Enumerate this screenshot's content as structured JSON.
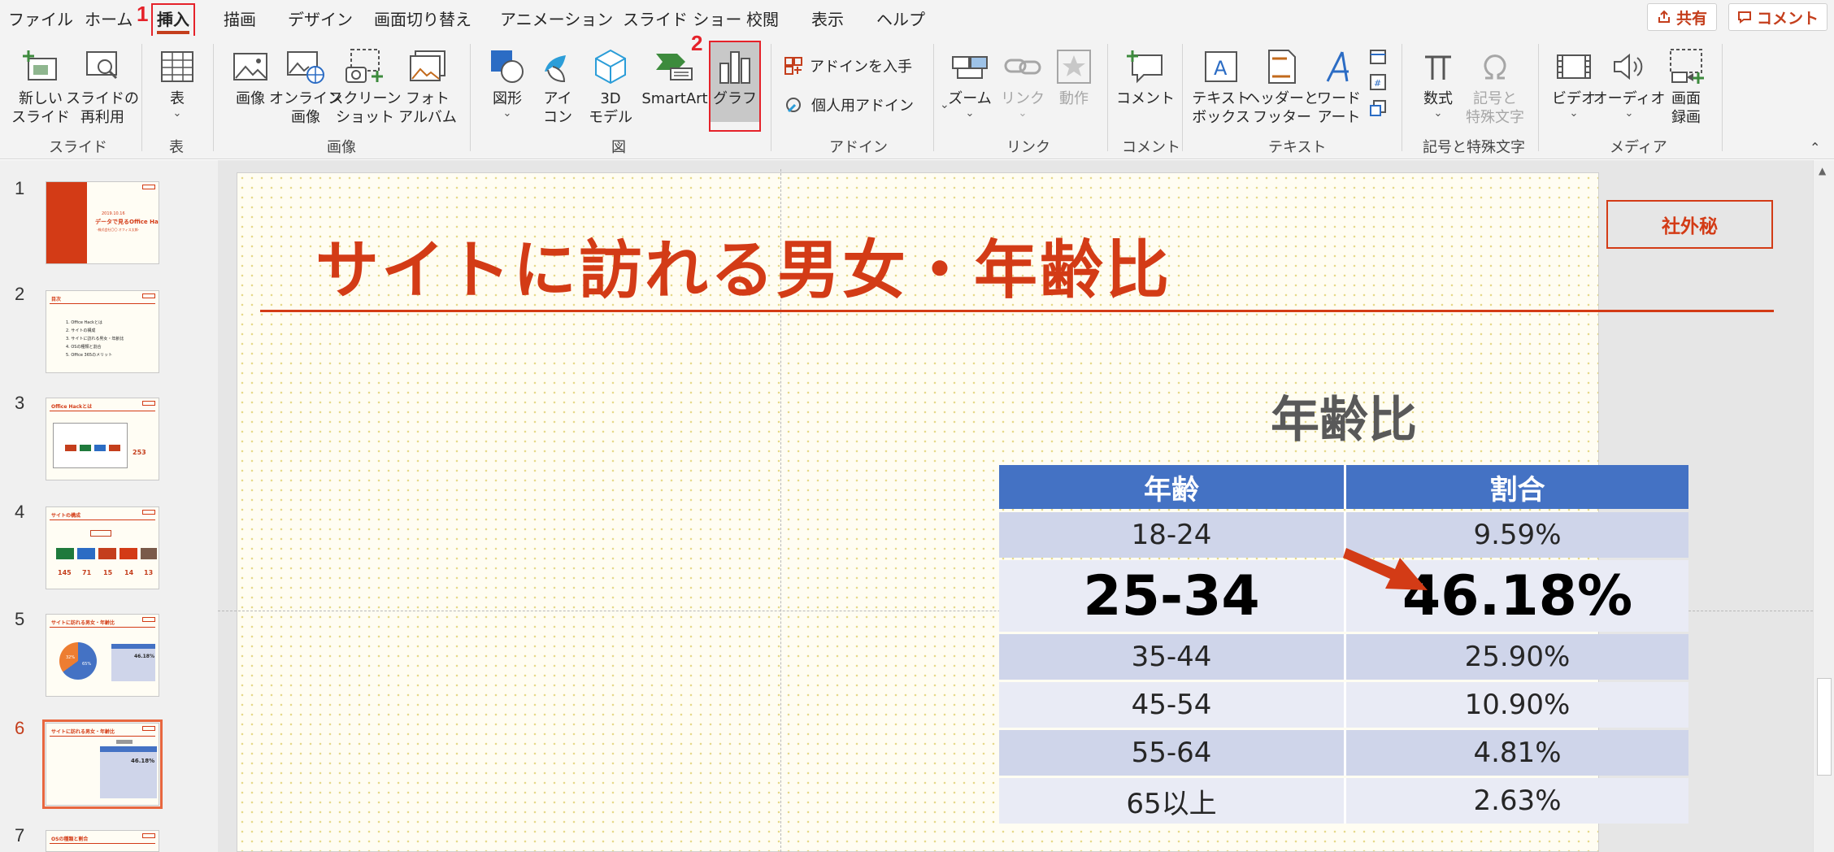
{
  "menu": {
    "items": [
      "ファイル",
      "ホーム",
      "挿入",
      "描画",
      "デザイン",
      "画面切り替え",
      "アニメーション",
      "スライド ショー",
      "校閲",
      "表示",
      "ヘルプ"
    ],
    "share_label": "共有",
    "comment_label": "コメント"
  },
  "annotations": {
    "step1": "1",
    "step2": "2"
  },
  "ribbon": {
    "new_slide": [
      "新しい",
      "スライド"
    ],
    "reuse_slide": [
      "スライドの",
      "再利用"
    ],
    "table": "表",
    "image": "画像",
    "online_image": [
      "オンライン",
      "画像"
    ],
    "screenshot": [
      "スクリーン",
      "ショット"
    ],
    "photo_album": [
      "フォト",
      "アルバム"
    ],
    "shapes": "図形",
    "icons": [
      "アイ",
      "コン"
    ],
    "model3d": [
      "3D",
      "モデル"
    ],
    "smartart": "SmartArt",
    "chart": "グラフ",
    "get_addins": "アドインを入手",
    "my_addins": "個人用アドイン",
    "zoom": "ズーム",
    "link": "リンク",
    "action": "動作",
    "comment": "コメント",
    "textbox": [
      "テキスト",
      "ボックス"
    ],
    "header_footer": [
      "ヘッダーと",
      "フッター"
    ],
    "wordart": [
      "ワード",
      "アート"
    ],
    "equation": "数式",
    "symbol": [
      "記号と",
      "特殊文字"
    ],
    "video": "ビデオ",
    "audio": "オーディオ",
    "screen_recording": [
      "画面",
      "録画"
    ],
    "groups": [
      "スライド",
      "表",
      "画像",
      "図",
      "アドイン",
      "リンク",
      "コメント",
      "テキスト",
      "記号と特殊文字",
      "メディア"
    ]
  },
  "thumbnails": [
    {
      "num": "1",
      "title": "2019.10.16",
      "subtitle": "データで見るOffice Hack",
      "byline": "-株式会社〇〇 オフィス太郎-"
    },
    {
      "num": "2",
      "title": "目次",
      "lines": [
        "1. Office Hackとは",
        "2. サイトの構成",
        "3. サイトに訪れる男女・年齢比",
        "4. OSの種類と割合",
        "5. Office 365のメリット"
      ]
    },
    {
      "num": "3",
      "title": "Office Hackとは",
      "figure": "253"
    },
    {
      "num": "4",
      "title": "サイトの構成",
      "figures": [
        "145",
        "71",
        "15",
        "14",
        "13"
      ]
    },
    {
      "num": "5",
      "title": "サイトに訪れる男女・年齢比",
      "pie": [
        "32%",
        "65%"
      ],
      "highlight": "46.18%"
    },
    {
      "num": "6",
      "title": "サイトに訪れる男女・年齢比",
      "highlight": "46.18%"
    },
    {
      "num": "7",
      "title": "OSの種類と割合"
    }
  ],
  "slide": {
    "title": "サイトに訪れる男女・年齢比",
    "badge": "社外秘",
    "table_title": "年齢比",
    "table": {
      "headers": [
        "年齢",
        "割合"
      ],
      "rows": [
        [
          "18-24",
          "9.59%"
        ],
        [
          "25-34",
          "46.18%"
        ],
        [
          "35-44",
          "25.90%"
        ],
        [
          "45-54",
          "10.90%"
        ],
        [
          "55-64",
          "4.81%"
        ],
        [
          "65以上",
          "2.63%"
        ]
      ]
    }
  },
  "colors": {
    "accent": "#d33b16",
    "annotation_red": "#e5222a",
    "table_header": "#4472c4",
    "row_odd": "#cfd5ea",
    "row_even": "#e9ebf5"
  }
}
